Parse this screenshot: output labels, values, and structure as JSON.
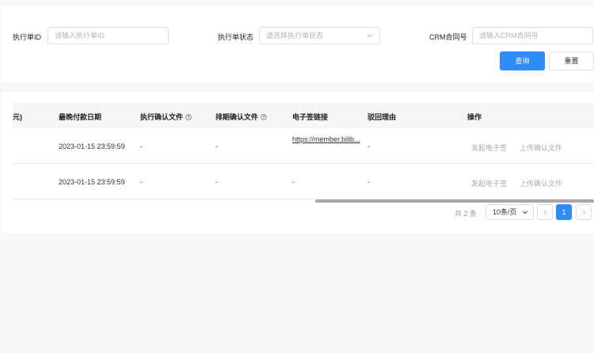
{
  "filters": {
    "exec_id_label": "执行单ID",
    "exec_id_placeholder": "请输入执行单ID",
    "status_label": "执行单状态",
    "status_placeholder": "请选择执行单状态",
    "crm_label": "CRM合同号",
    "crm_placeholder": "请输入CRM合同号",
    "search_label": "查询",
    "reset_label": "重置"
  },
  "table": {
    "columns": {
      "partial_col": "元)",
      "latest_pay_date": "最晚付款日期",
      "exec_confirm_file": "执行确认文件",
      "schedule_confirm_file": "排期确认文件",
      "esign_link": "电子签链接",
      "reject_reason": "驳回理由",
      "actions": "操作"
    },
    "rows": [
      {
        "latest_pay_date": "2023-01-15 23:59:59",
        "exec_confirm_file": "-",
        "schedule_confirm_file": "-",
        "esign_link": "https://member.bilib...",
        "reject_reason": "-",
        "action_esign": "发起电子签",
        "action_upload": "上传确认文件"
      },
      {
        "latest_pay_date": "2023-01-15 23:59:59",
        "exec_confirm_file": "-",
        "schedule_confirm_file": "-",
        "esign_link": "-",
        "reject_reason": "-",
        "action_esign": "发起电子签",
        "action_upload": "上传确认文件"
      }
    ]
  },
  "pagination": {
    "total_text": "共 2 条",
    "page_size": "10条/页",
    "current_page": "1"
  },
  "colors": {
    "primary": "#2f8bf5",
    "muted_action": "#a9abae"
  }
}
